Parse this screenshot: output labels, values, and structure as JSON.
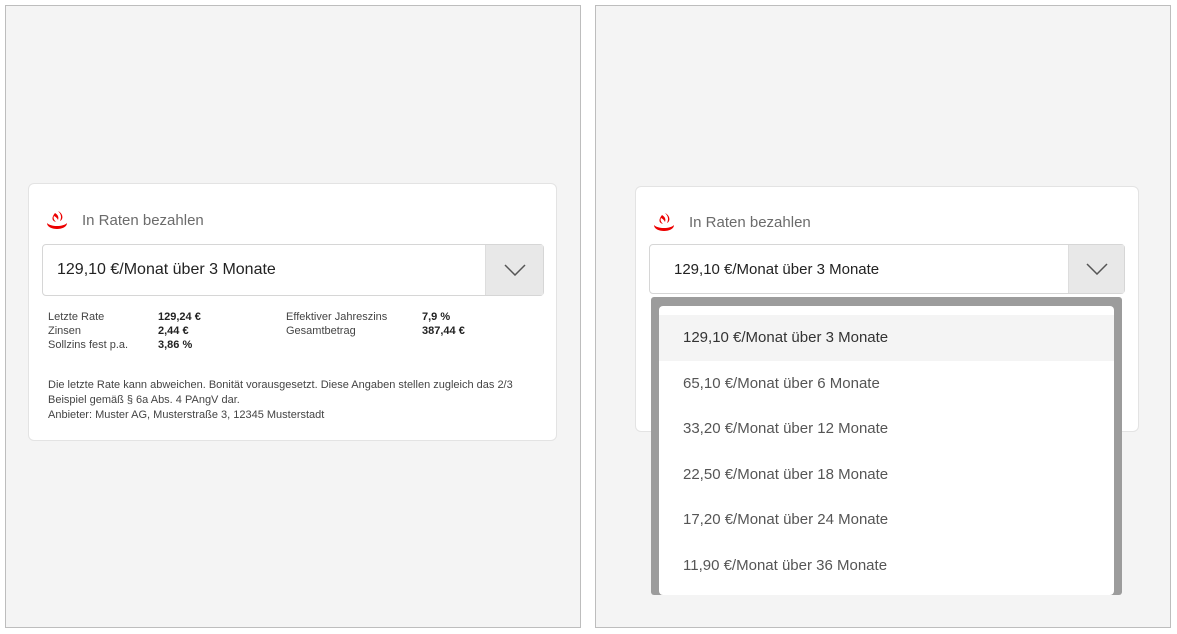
{
  "header": {
    "title": "In Raten bezahlen"
  },
  "colors": {
    "brand_red": "#ec0000",
    "panel_bg": "#f4f4f4",
    "dropdown_frame": "#9c9c9c"
  },
  "select": {
    "value": "129,10 €/Monat über 3 Monate",
    "arrow_icon": "chevron-down-icon"
  },
  "details": {
    "letzte_rate_label": "Letzte Rate",
    "letzte_rate_value": "129,24 €",
    "zinsen_label": "Zinsen",
    "zinsen_value": "2,44 €",
    "sollzins_label": "Sollzins fest p.a.",
    "sollzins_value": "3,86 %",
    "eff_label": "Effektiver Jahreszins",
    "eff_value": "7,9 %",
    "gesamt_label": "Gesamtbetrag",
    "gesamt_value": "387,44 €"
  },
  "disclaimer": {
    "line1": "Die letzte Rate kann abweichen. Bonität vorausgesetzt. Diese Angaben stellen zugleich das 2/3 Beispiel gemäß § 6a Abs. 4 PAngV dar.",
    "line2": "Anbieter: Muster AG, Musterstraße 3, 12345 Musterstadt"
  },
  "dropdown": {
    "options": [
      "129,10 €/Monat über 3 Monate",
      "65,10 €/Monat über 6 Monate",
      "33,20 €/Monat über 12 Monate",
      "22,50 €/Monat über 18 Monate",
      "17,20 €/Monat über 24 Monate",
      "11,90 €/Monat über 36 Monate"
    ]
  }
}
